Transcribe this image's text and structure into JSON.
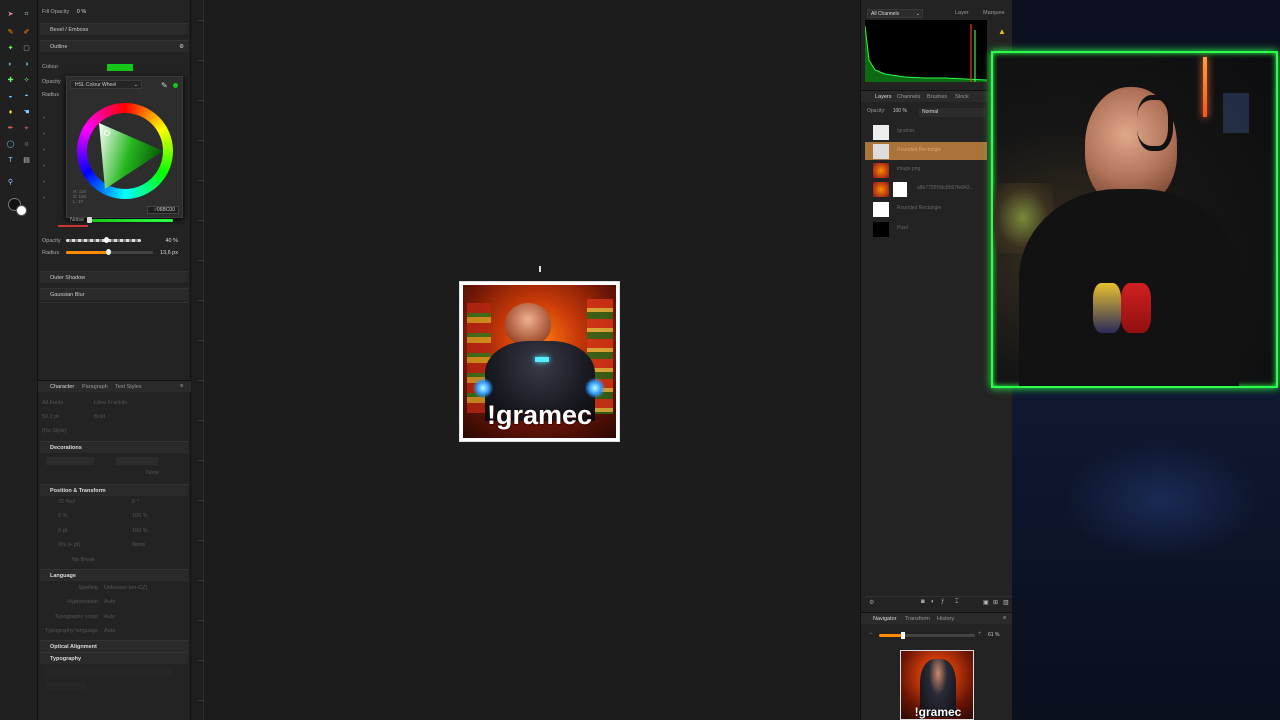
{
  "colors": {
    "accent_green": "#2bff4a",
    "fill_green": "#16c61a",
    "orange": "#ff8a00",
    "layer_selected": "#a9733a"
  },
  "left_panel": {
    "fill_opacity_label": "Fill Opacity",
    "fill_opacity_value": "0 %",
    "bevel_label": "Bevel / Emboss",
    "outline_label": "Outline",
    "colour_label": "Colour",
    "opacity_label": "Opacity",
    "radius_label": "Radius",
    "picker_mode": "HSL Colour Wheel",
    "picker_h": "H: 118",
    "picker_s": "S: 100",
    "picker_l": "L: 37",
    "hex_value": "06BC00",
    "noise_label": "Noise",
    "opacity2_label": "Opacity",
    "opacity2_value": "40 %",
    "radius2_label": "Radius",
    "radius2_value": "13,6 px",
    "outer_shadow_label": "Outer Shadow",
    "gaussian_blur_label": "Gaussian Blur"
  },
  "character": {
    "tabs": [
      "Character",
      "Paragraph",
      "Text Styles"
    ],
    "font_collection": "All Fonts",
    "font_name": "Libre Franklin",
    "font_size": "59,1 pt",
    "font_weight": "Bold",
    "no_style": "(No Style)",
    "decorations_label": "Decorations",
    "none_label": "None",
    "position_label": "Position & Transform",
    "pt_rows": [
      [
        "72 %ul",
        "0 °"
      ],
      [
        "0 %",
        "100 %"
      ],
      [
        "0 pt",
        "100 %"
      ],
      [
        "0% (+ pt)",
        "None"
      ]
    ],
    "no_break": "No Break",
    "language_label": "Language",
    "spelling_label": "Spelling",
    "spelling_value": "Unknown (en-CZ)",
    "hyphenation_label": "Hyphenation",
    "hyphenation_value": "Auto",
    "typo_script_label": "Typography script",
    "typo_script_value": "Auto",
    "typo_lang_label": "Typography language",
    "typo_lang_value": "Auto",
    "optical_alignment": "Optical Alignment",
    "typography": "Typography"
  },
  "artboard": {
    "caption": "!gramec"
  },
  "right_panel": {
    "channels_select": "All Channels",
    "layer_tab": "Layer",
    "marquee_tab": "Marquee",
    "tabs": [
      "Layers",
      "Channels",
      "Brushes",
      "Stock"
    ],
    "opacity_label": "Opacity:",
    "opacity_value": "100 %",
    "blend_mode": "Normal",
    "layers": [
      {
        "name": "!gramec"
      },
      {
        "name": "Rounded Rectangle"
      },
      {
        "name": "image.png"
      },
      {
        "name": "a8b7795f3dc8067fe843..."
      },
      {
        "name": "Rounded Rectangle"
      },
      {
        "name": "Pixel"
      }
    ],
    "nav_tabs": [
      "Navigator",
      "Transform",
      "History"
    ],
    "zoom_value": "61 %",
    "nav_caption": "!gramec"
  }
}
